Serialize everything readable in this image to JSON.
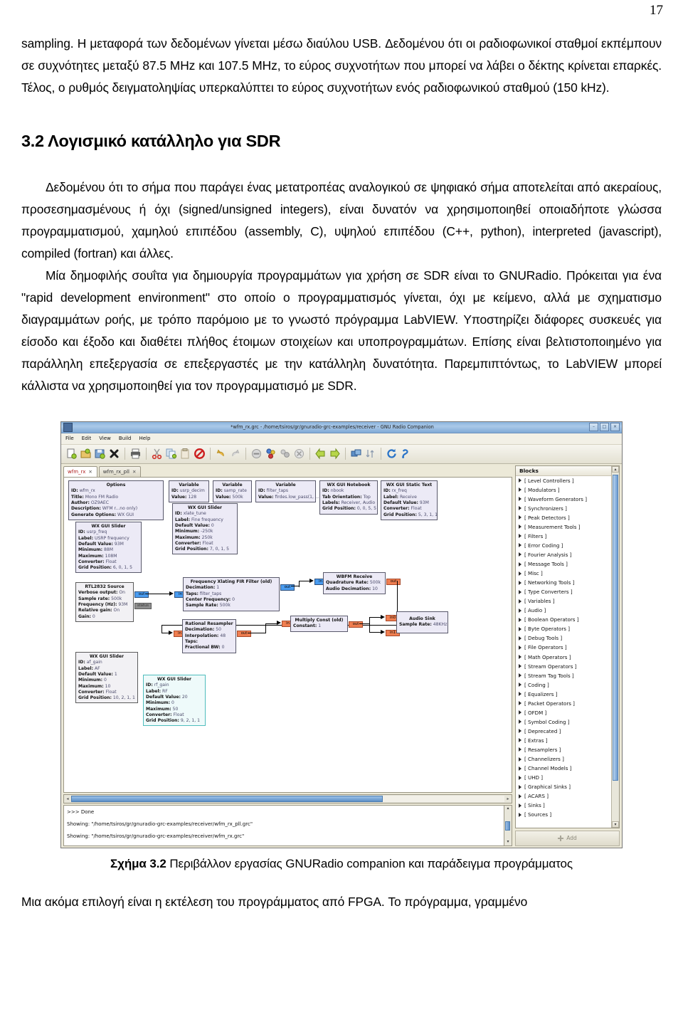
{
  "page": {
    "number": "17"
  },
  "document": {
    "paragraph_1": "sampling. Η μεταφορά των δεδομένων γίνεται μέσω διαύλου USB. Δεδομένου ότι οι ραδιοφωνικοί σταθμοί εκπέμπουν σε συχνότητες μεταξύ 87.5 MHz και 107.5 MHz, το εύρος συχνοτήτων που μπορεί να λάβει ο δέκτης κρίνεται επαρκές. Τέλος, ο ρυθμός δειγματοληψίας υπερκαλύπτει το εύρος συχνοτήτων ενός ραδιοφωνικού σταθμού (150 kHz).",
    "section_heading": "3.2 Λογισμικό κατάλληλο για SDR",
    "paragraph_2": "Δεδομένου ότι το σήμα που παράγει ένας μετατροπέας αναλογικού σε ψηφιακό σήμα αποτελείται από ακεραίους, προσεσημασμένους ή όχι (signed/unsigned integers), είναι δυνατόν να χρησιμοποιηθεί οποιαδήποτε γλώσσα προγραμματισμού, χαμηλού επιπέδου (assembly, C), υψηλού επιπέδου (C++, python), interpreted (javascript), compiled (fortran) και άλλες.",
    "paragraph_3": "Μία δημοφιλής σουΐτα για δημιουργία προγραμμάτων για χρήση σε SDR είναι το GNURadio. Πρόκειται για ένα \"rapid development environment\" στο οποίο ο προγραμματισμός γίνεται, όχι με κείμενο, αλλά με σχηματισμο διαγραμμάτων ροής, με τρόπο παρόμοιο με το γνωστό πρόγραμμα LabVIEW. Υποστηρίζει διάφορες συσκευές για είσοδο και έξοδο και διαθέτει πλήθος έτοιμων στοιχείων και υποπρογραμμάτων. Επίσης είναι βελτιστοποιημένο για παράλληλη επεξεργασία σε επεξεργαστές με την κατάλληλη δυνατότητα. Παρεμπιπτόντως, το LabVIEW μπορεί κάλλιστα να χρησιμοποιηθεί για τον προγραμματισμό με SDR.",
    "figure_caption_label": "Σχήμα 3.2",
    "figure_caption_text": " Περιβάλλον εργασίας GNURadio companion και παράδειγμα προγράμματος",
    "paragraph_4": "Μια ακόμα επιλογή είναι η εκτέλεση του προγράμματος από FPGA. Το πρόγραμμα, γραμμένο"
  },
  "grc": {
    "titlebar": {
      "title": "*wfm_rx.grc - /home/tsiros/gr/gnuradio-grc-examples/receiver - GNU Radio Companion",
      "minimize": "–",
      "maximize": "□",
      "close": "×"
    },
    "menu": [
      "File",
      "Edit",
      "View",
      "Build",
      "Help"
    ],
    "toolbar_icons": [
      "new-file-icon",
      "open-file-icon",
      "save-file-icon",
      "close-file-icon",
      "print-icon",
      "cut-icon",
      "copy-icon",
      "paste-icon",
      "delete-icon",
      "undo-icon",
      "redo-icon",
      "stop-icon",
      "generate-icon",
      "execute-icon",
      "kill-icon",
      "rotate-left-icon",
      "rotate-right-icon",
      "enable-icon",
      "disable-icon",
      "reload-icon",
      "help-icon"
    ],
    "tabs": [
      {
        "label": "wfm_rx",
        "close": "✕",
        "active": true
      },
      {
        "label": "wfm_rx_pll",
        "close": "✕",
        "active": false
      }
    ],
    "blocks_panel": {
      "header": "Blocks",
      "add_label": "Add",
      "items": [
        "[ Level Controllers ]",
        "[ Modulators ]",
        "[ Waveform Generators ]",
        "[ Synchronizers ]",
        "[ Peak Detectors ]",
        "[ Measurement Tools ]",
        "[ Filters ]",
        "[ Error Coding ]",
        "[ Fourier Analysis ]",
        "[ Message Tools ]",
        "[ Misc ]",
        "[ Networking Tools ]",
        "[ Type Converters ]",
        "[ Variables ]",
        "[ Audio ]",
        "[ Boolean Operators ]",
        "[ Byte Operators ]",
        "[ Debug Tools ]",
        "[ File Operators ]",
        "[ Math Operators ]",
        "[ Stream Operators ]",
        "[ Stream Tag Tools ]",
        "[ Coding ]",
        "[ Equalizers ]",
        "[ Packet Operators ]",
        "[ OFDM ]",
        "[ Symbol Coding ]",
        "[ Deprecated ]",
        "[ Extras ]",
        "[ Resamplers ]",
        "[ Channelizers ]",
        "[ Channel Models ]",
        "[ UHD ]",
        "[ Graphical Sinks ]",
        "[ ACARS ]",
        "[ Sinks ]",
        "[ Sources ]"
      ]
    },
    "console": {
      "line1": ">>> Done",
      "line2": "Showing: \"/home/tsiros/gr/gnuradio-grc-examples/receiver/wfm_rx_pll.grc\"",
      "line3": "Showing: \"/home/tsiros/gr/gnuradio-grc-examples/receiver/wfm_rx.grc\""
    },
    "flowgraph": {
      "options": {
        "title": "Options",
        "rows": [
          {
            "k": "ID:",
            "v": "wfm_rx"
          },
          {
            "k": "Title:",
            "v": "Mono FM Radio"
          },
          {
            "k": "Author:",
            "v": "OZ9AEC"
          },
          {
            "k": "Description:",
            "v": "WFM r...no only)"
          },
          {
            "k": "Generate Options:",
            "v": "WX GUI"
          }
        ]
      },
      "var_usrp_decim": {
        "title": "Variable",
        "rows": [
          {
            "k": "ID:",
            "v": "usrp_decim"
          },
          {
            "k": "Value:",
            "v": "128"
          }
        ]
      },
      "var_samp_rate": {
        "title": "Variable",
        "rows": [
          {
            "k": "ID:",
            "v": "samp_rate"
          },
          {
            "k": "Value:",
            "v": "500k"
          }
        ]
      },
      "var_filter_taps": {
        "title": "Variable",
        "rows": [
          {
            "k": "ID:",
            "v": "filter_taps"
          },
          {
            "k": "Value:",
            "v": "firdes.low_pass(1, ..."
          }
        ]
      },
      "notebook": {
        "title": "WX GUI Notebook",
        "rows": [
          {
            "k": "ID:",
            "v": "nbook"
          },
          {
            "k": "Tab Orientation:",
            "v": "Top"
          },
          {
            "k": "Labels:",
            "v": "Receiver, Audio"
          },
          {
            "k": "Grid Position:",
            "v": "0, 0, 5, 5"
          }
        ]
      },
      "static_text": {
        "title": "WX GUI Static Text",
        "rows": [
          {
            "k": "ID:",
            "v": "rx_freq"
          },
          {
            "k": "Label:",
            "v": "Receive"
          },
          {
            "k": "Default Value:",
            "v": "93M"
          },
          {
            "k": "Converter:",
            "v": "Float"
          },
          {
            "k": "Grid Position:",
            "v": "5, 3, 1, 1"
          }
        ]
      },
      "slider_usrp_freq": {
        "title": "WX GUI Slider",
        "rows": [
          {
            "k": "ID:",
            "v": "usrp_freq"
          },
          {
            "k": "Label:",
            "v": "USRP frequency"
          },
          {
            "k": "Default Value:",
            "v": "93M"
          },
          {
            "k": "Minimum:",
            "v": "88M"
          },
          {
            "k": "Maximum:",
            "v": "108M"
          },
          {
            "k": "Converter:",
            "v": "Float"
          },
          {
            "k": "Grid Position:",
            "v": "6, 0, 1, 5"
          }
        ]
      },
      "slider_xlate_tune": {
        "title": "WX GUI Slider",
        "rows": [
          {
            "k": "ID:",
            "v": "xlate_tune"
          },
          {
            "k": "Label:",
            "v": "Fine frequency"
          },
          {
            "k": "Default Value:",
            "v": "0"
          },
          {
            "k": "Minimum:",
            "v": "-250k"
          },
          {
            "k": "Maximum:",
            "v": "250k"
          },
          {
            "k": "Converter:",
            "v": "Float"
          },
          {
            "k": "Grid Position:",
            "v": "7, 0, 1, 5"
          }
        ]
      },
      "rtl_source": {
        "title": "RTL2832 Source",
        "rows": [
          {
            "k": "Verbose output:",
            "v": "On"
          },
          {
            "k": "Sample rate:",
            "v": "500k"
          },
          {
            "k": "Frequency (Hz):",
            "v": "93M"
          },
          {
            "k": "Relative gain:",
            "v": "On"
          },
          {
            "k": "Gain:",
            "v": "0"
          }
        ],
        "port_out": "out",
        "port_status": "status"
      },
      "xlating_filter": {
        "title": "Frequency Xlating FIR Filter (old)",
        "rows": [
          {
            "k": "Decimation:",
            "v": "1"
          },
          {
            "k": "Taps:",
            "v": "filter_taps"
          },
          {
            "k": "Center Frequency:",
            "v": "0"
          },
          {
            "k": "Sample Rate:",
            "v": "500k"
          }
        ],
        "port_in": "in",
        "port_out": "out"
      },
      "wbfm": {
        "title": "WBFM Receive",
        "rows": [
          {
            "k": "Quadrature Rate:",
            "v": "500k"
          },
          {
            "k": "Audio Decimation:",
            "v": "10"
          }
        ],
        "port_in": "in",
        "port_out": "out"
      },
      "resampler": {
        "title": "Rational Resampler",
        "rows": [
          {
            "k": "Decimation:",
            "v": "50"
          },
          {
            "k": "Interpolation:",
            "v": "48"
          },
          {
            "k": "Taps:",
            "v": ""
          },
          {
            "k": "Fractional BW:",
            "v": "0"
          }
        ],
        "port_in": "in",
        "port_out": "out"
      },
      "multiply": {
        "title": "Multiply Const (old)",
        "rows": [
          {
            "k": "Constant:",
            "v": "1"
          }
        ],
        "port_in": "in",
        "port_out": "out"
      },
      "audio_sink": {
        "title": "Audio Sink",
        "rows": [
          {
            "k": "Sample Rate:",
            "v": "48KHz"
          }
        ],
        "port_in0": "in0",
        "port_in1": "in1"
      },
      "slider_af_gain": {
        "title": "WX GUI Slider",
        "rows": [
          {
            "k": "ID:",
            "v": "af_gain"
          },
          {
            "k": "Label:",
            "v": "AF"
          },
          {
            "k": "Default Value:",
            "v": "1"
          },
          {
            "k": "Minimum:",
            "v": "0"
          },
          {
            "k": "Maximum:",
            "v": "10"
          },
          {
            "k": "Converter:",
            "v": "Float"
          },
          {
            "k": "Grid Position:",
            "v": "10, 2, 1, 1"
          }
        ]
      },
      "slider_rf_gain": {
        "title": "WX GUI Slider",
        "rows": [
          {
            "k": "ID:",
            "v": "rf_gain"
          },
          {
            "k": "Label:",
            "v": "RF"
          },
          {
            "k": "Default Value:",
            "v": "20"
          },
          {
            "k": "Minimum:",
            "v": "0"
          },
          {
            "k": "Maximum:",
            "v": "50"
          },
          {
            "k": "Converter:",
            "v": "Float"
          },
          {
            "k": "Grid Position:",
            "v": "9, 2, 1, 1"
          }
        ]
      }
    }
  }
}
